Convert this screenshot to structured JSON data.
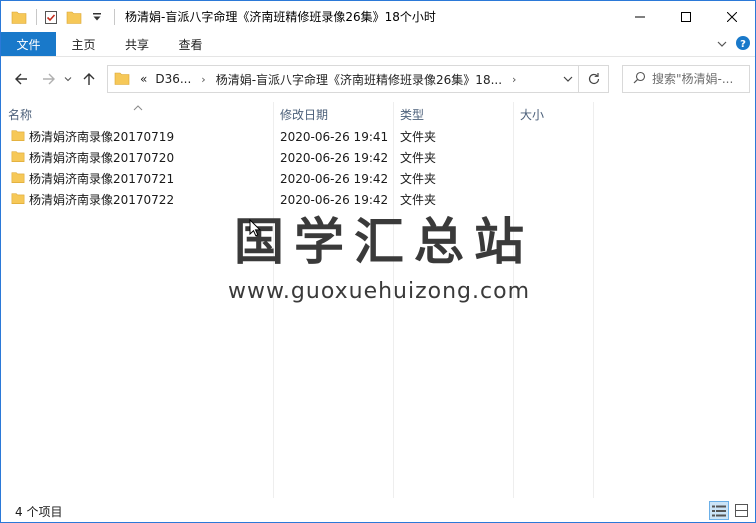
{
  "window": {
    "title": "杨清娟-盲派八字命理《济南班精修班录像26集》18个小时"
  },
  "ribbon": {
    "tabs": [
      "文件",
      "主页",
      "共享",
      "查看"
    ]
  },
  "address": {
    "segments": [
      "D36...",
      "杨清娟-盲派八字命理《济南班精修班录像26集》18..."
    ],
    "overflow": "«"
  },
  "search": {
    "placeholder": "搜索\"杨清娟-..."
  },
  "columns": {
    "name": "名称",
    "date": "修改日期",
    "type": "类型",
    "size": "大小"
  },
  "files": [
    {
      "name": "杨清娟济南录像20170719",
      "date": "2020-06-26 19:41",
      "type": "文件夹",
      "size": ""
    },
    {
      "name": "杨清娟济南录像20170720",
      "date": "2020-06-26 19:42",
      "type": "文件夹",
      "size": ""
    },
    {
      "name": "杨清娟济南录像20170721",
      "date": "2020-06-26 19:42",
      "type": "文件夹",
      "size": ""
    },
    {
      "name": "杨清娟济南录像20170722",
      "date": "2020-06-26 19:42",
      "type": "文件夹",
      "size": ""
    }
  ],
  "watermark": {
    "brand": "国学汇总站",
    "url": "www.guoxuehuizong.com"
  },
  "status": {
    "item_count": "4 个项目"
  },
  "colors": {
    "accent": "#1979ca",
    "folder": "#f6c858",
    "header_text": "#4c607a"
  }
}
